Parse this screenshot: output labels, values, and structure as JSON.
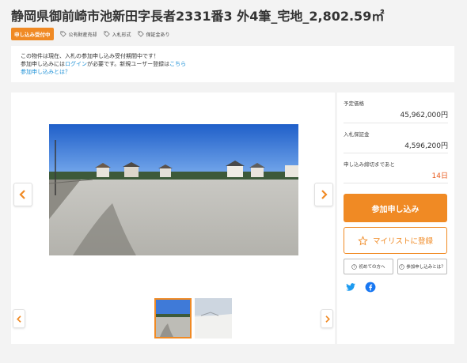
{
  "property": {
    "title": "静岡県御前崎市池新田字長者2331番3 外4筆_宅地_2,802.59㎡",
    "status_badge": "申し込み受付中",
    "tags": [
      "公有財産売却",
      "入札形式",
      "保証金あり"
    ]
  },
  "notice": {
    "line1": "この物件は現在、入札の参加申し込み受付期間中です！",
    "line2_prefix": "参加申し込みには",
    "login_link": "ログイン",
    "line2_middle": "が必要です。新規ユーザー登録は",
    "register_link": "こちら",
    "help_link": "参加申し込みとは？"
  },
  "details": {
    "price_label": "予定価格",
    "price_value": "45,962,000円",
    "deposit_label": "入札保証金",
    "deposit_value": "4,596,200円",
    "deadline_label": "申し込み締切まであと",
    "deadline_value": "14日"
  },
  "actions": {
    "apply": "参加申し込み",
    "favorite": "マイリストに登録",
    "first_time": "初めての方へ",
    "about_apply": "参加申し込みとは？"
  },
  "icons": {
    "tag": "tag-icon",
    "star": "star-icon",
    "help": "help-circle-icon",
    "twitter": "twitter-icon",
    "facebook": "facebook-icon",
    "prev": "chevron-left-icon",
    "next": "chevron-right-icon"
  },
  "colors": {
    "accent": "#f08a24",
    "link": "#1a8fd6",
    "deadline": "#e85a1c"
  }
}
